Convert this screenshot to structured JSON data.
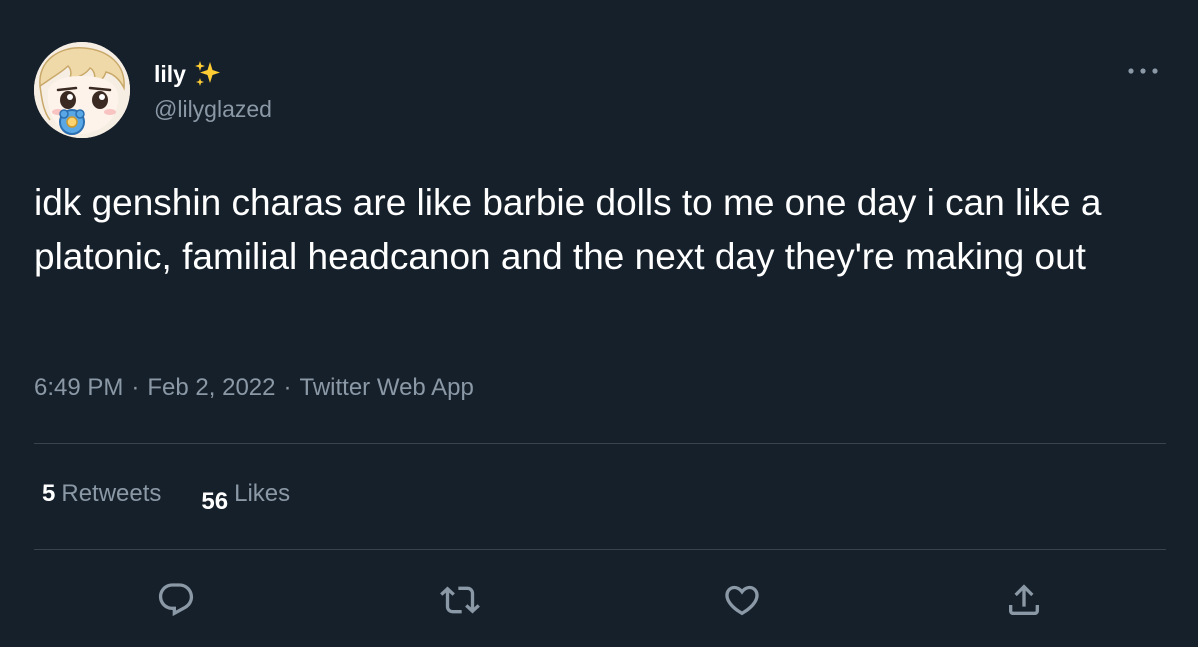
{
  "author": {
    "display_name": "lily",
    "emoji": "✨",
    "handle": "@lilyglazed",
    "avatar_icon": "anime-avatar-icon"
  },
  "tweet": {
    "text": "idk genshin charas are like barbie dolls to me one day i can like a platonic, familial headcanon and the next day they're making out"
  },
  "meta": {
    "time": "6:49 PM",
    "separator": "·",
    "date": "Feb 2, 2022",
    "source": "Twitter Web App"
  },
  "stats": {
    "retweets_count": "5",
    "retweets_label": "Retweets",
    "likes_count": "56",
    "likes_label": "Likes"
  },
  "actions": [
    {
      "name": "reply",
      "icon": "reply-icon"
    },
    {
      "name": "retweet",
      "icon": "retweet-icon"
    },
    {
      "name": "like",
      "icon": "heart-icon"
    },
    {
      "name": "share",
      "icon": "share-icon"
    }
  ],
  "colors": {
    "background": "#15202b",
    "primary_text": "#ffffff",
    "secondary_text": "#8b98a5",
    "divider": "#38444d"
  }
}
